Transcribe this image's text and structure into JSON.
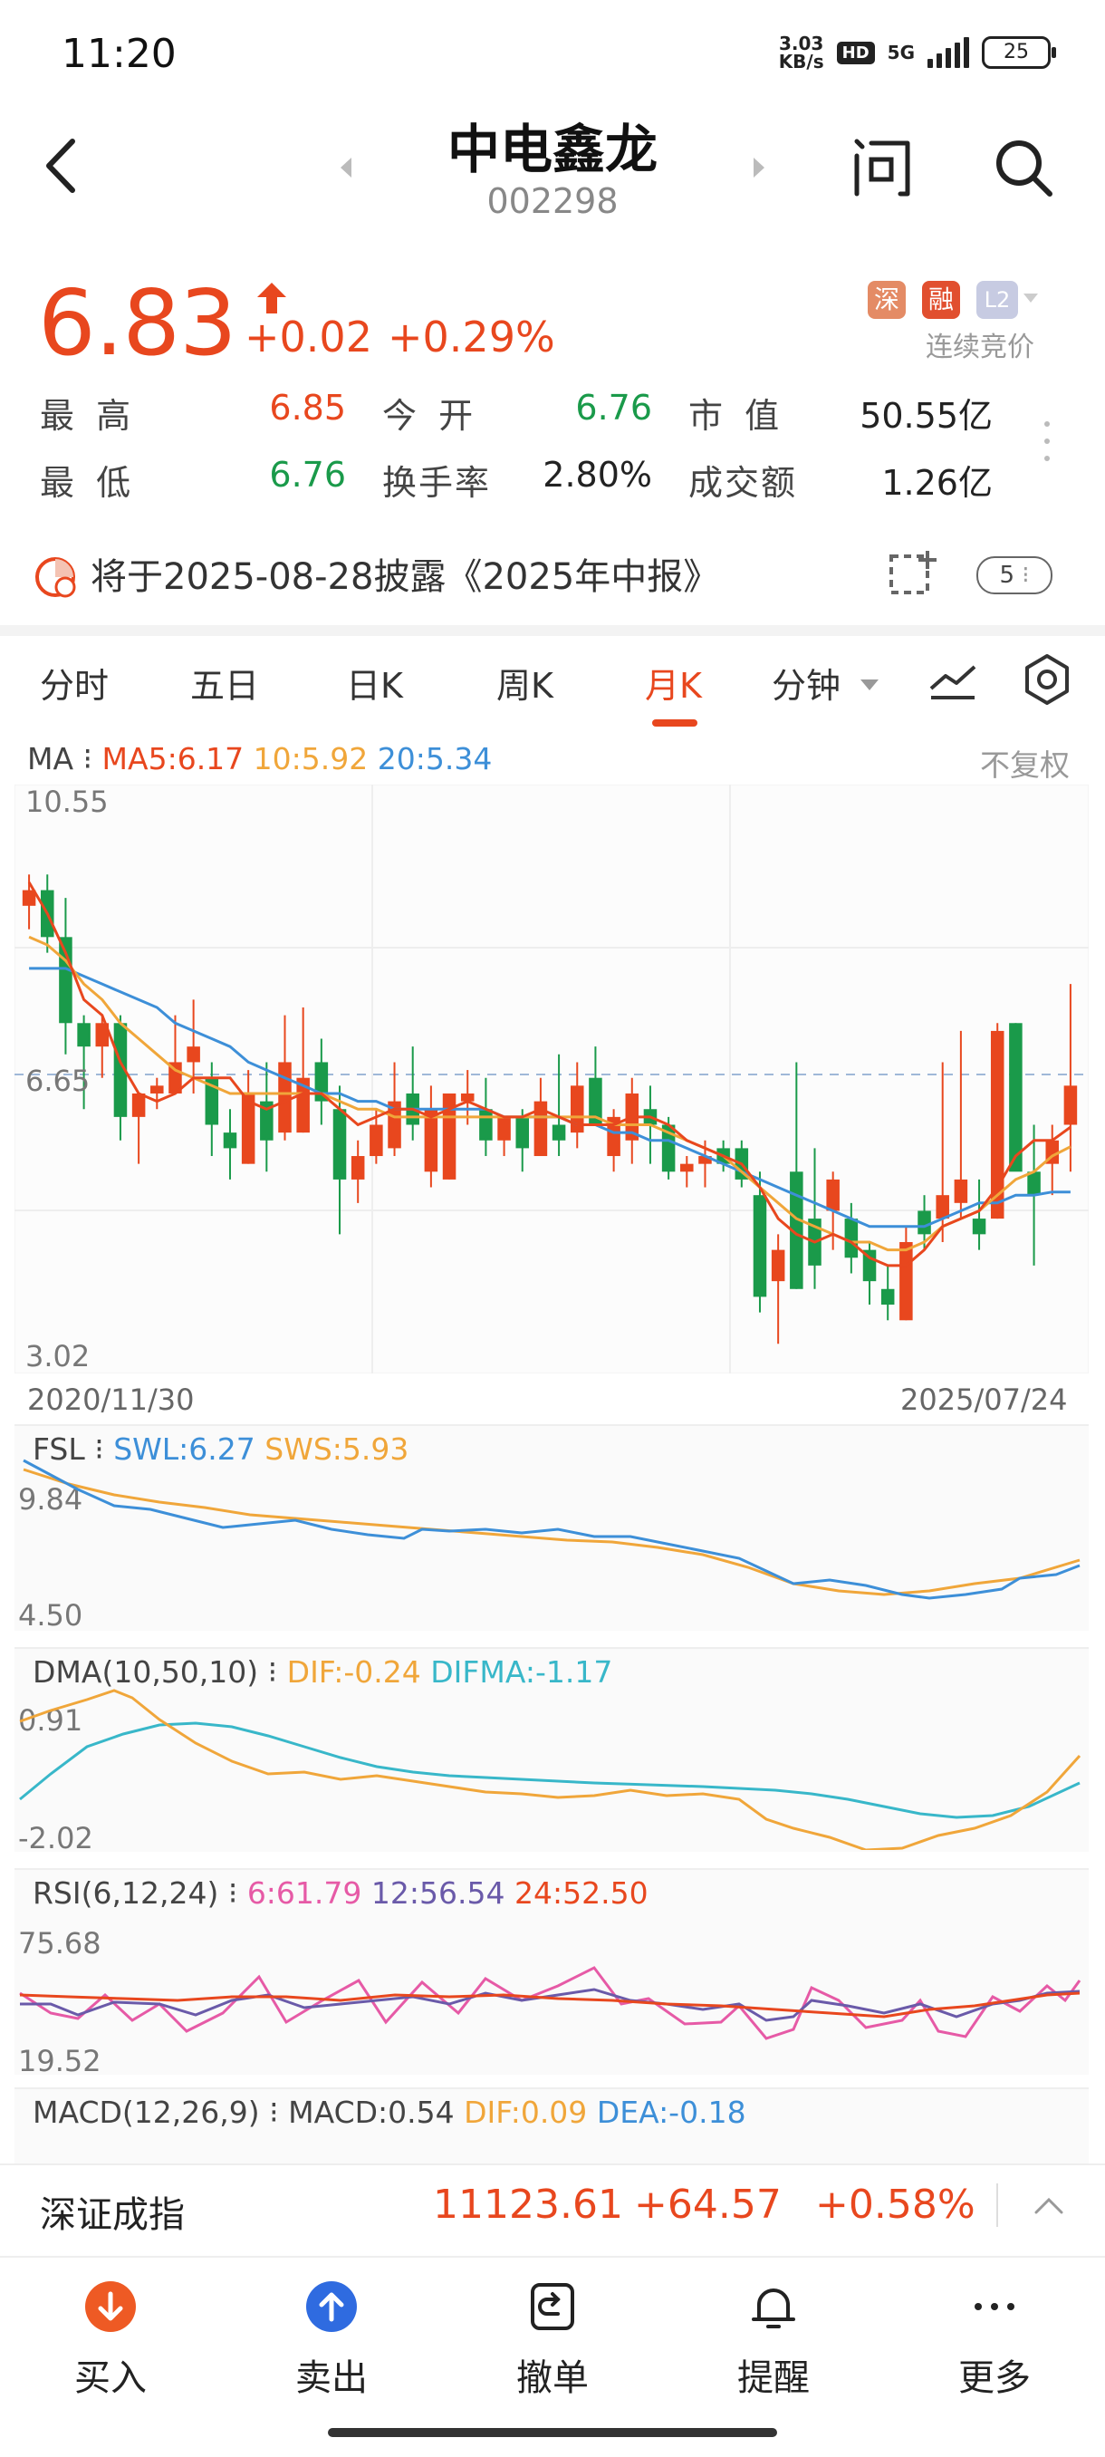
{
  "status": {
    "time": "11:20",
    "speed_top": "3.03",
    "speed_bottom": "KB/s",
    "hd": "HD",
    "net": "5G",
    "battery": "25"
  },
  "header": {
    "title": "中电鑫龙",
    "code": "002298"
  },
  "quote": {
    "price": "6.83",
    "change": "+0.02",
    "change_pct": "+0.29%",
    "badge_shen": "深",
    "badge_rong": "融",
    "badge_l2": "L2",
    "auction": "连续竞价",
    "high_label": "最 高",
    "high": "6.85",
    "open_label": "今 开",
    "open": "6.76",
    "mcap_label": "市 值",
    "mcap": "50.55亿",
    "low_label": "最 低",
    "low": "6.76",
    "turnover_label": "换手率",
    "turnover": "2.80%",
    "amount_label": "成交额",
    "amount": "1.26亿"
  },
  "notice": {
    "text": "将于2025-08-28披露《2025年中报》",
    "count": "5"
  },
  "tabs": [
    "分时",
    "五日",
    "日K",
    "周K",
    "月K",
    "分钟"
  ],
  "active_tab": "月K",
  "colors": {
    "red": "#e8471e",
    "green": "#1a9a4a",
    "orange": "#f0a63a",
    "blue": "#3d8fd8",
    "cyan": "#38b7c9",
    "pink": "#e65aa6",
    "purple": "#6a5aa9"
  },
  "main_chart": {
    "legend_title": "MA",
    "ma5": "MA5:6.17",
    "ma10": "10:5.92",
    "ma20": "20:5.34",
    "adjust": "不复权",
    "y_top": "10.55",
    "y_mid": "6.65",
    "y_bottom": "3.02",
    "date_start": "2020/11/30",
    "date_end": "2025/07/24"
  },
  "fsl": {
    "title": "FSL",
    "swl": "SWL:6.27",
    "sws": "SWS:5.93",
    "y_top": "9.84",
    "y_bottom": "4.50"
  },
  "dma": {
    "title": "DMA(10,50,10)",
    "dif": "DIF:-0.24",
    "difma": "DIFMA:-1.17",
    "y_top": "0.91",
    "y_bottom": "-2.02"
  },
  "rsi": {
    "title": "RSI(6,12,24)",
    "r6": "6:61.79",
    "r12": "12:56.54",
    "r24": "24:52.50",
    "y_top": "75.68",
    "y_bottom": "19.52"
  },
  "macd": {
    "title": "MACD(12,26,9)",
    "macd": "MACD:0.54",
    "dif": "DIF:0.09",
    "dea": "DEA:-0.18"
  },
  "index": {
    "name": "深证成指",
    "value": "11123.61",
    "change": "+64.57",
    "pct": "+0.58%"
  },
  "toolbar": {
    "buy": "买入",
    "sell": "卖出",
    "cancel": "撤单",
    "alert": "提醒",
    "more": "更多"
  },
  "chart_data": {
    "type": "candlestick",
    "x_range": [
      "2020/11/30",
      "2025/07/24"
    ],
    "ylim": [
      3.02,
      10.55
    ],
    "reference_price": 6.65,
    "candles": [
      [
        9.0,
        9.4,
        8.7,
        9.2
      ],
      [
        9.2,
        9.4,
        8.4,
        8.6
      ],
      [
        8.6,
        9.1,
        7.1,
        7.5
      ],
      [
        7.5,
        7.6,
        6.4,
        7.2
      ],
      [
        7.2,
        7.6,
        6.8,
        7.5
      ],
      [
        7.5,
        7.6,
        6.0,
        6.3
      ],
      [
        6.3,
        6.6,
        5.7,
        6.6
      ],
      [
        6.6,
        6.8,
        6.4,
        6.7
      ],
      [
        6.6,
        7.6,
        6.6,
        7.0
      ],
      [
        7.0,
        7.8,
        6.6,
        7.2
      ],
      [
        6.8,
        7.0,
        5.8,
        6.2
      ],
      [
        6.1,
        6.4,
        5.5,
        5.9
      ],
      [
        5.7,
        6.9,
        5.7,
        6.6
      ],
      [
        6.5,
        7.0,
        5.6,
        6.0
      ],
      [
        6.1,
        7.6,
        6.0,
        7.0
      ],
      [
        6.1,
        7.7,
        6.1,
        6.8
      ],
      [
        7.0,
        7.3,
        6.2,
        6.5
      ],
      [
        6.4,
        6.7,
        4.8,
        5.5
      ],
      [
        5.5,
        6.0,
        5.2,
        5.8
      ],
      [
        5.8,
        6.4,
        5.7,
        6.2
      ],
      [
        5.9,
        7.0,
        5.8,
        6.5
      ],
      [
        6.6,
        7.2,
        6.0,
        6.2
      ],
      [
        5.6,
        6.7,
        5.4,
        6.4
      ],
      [
        5.5,
        6.6,
        5.5,
        6.6
      ],
      [
        6.5,
        6.9,
        6.2,
        6.6
      ],
      [
        6.4,
        6.8,
        5.8,
        6.0
      ],
      [
        6.0,
        6.2,
        5.8,
        6.3
      ],
      [
        6.3,
        6.4,
        5.6,
        5.9
      ],
      [
        5.8,
        6.8,
        5.8,
        6.5
      ],
      [
        6.2,
        7.1,
        5.8,
        6.0
      ],
      [
        6.1,
        7.0,
        5.9,
        6.7
      ],
      [
        6.8,
        7.2,
        6.2,
        6.2
      ],
      [
        5.8,
        6.4,
        5.6,
        6.3
      ],
      [
        6.0,
        6.8,
        5.7,
        6.6
      ],
      [
        6.4,
        6.7,
        5.7,
        6.2
      ],
      [
        6.2,
        6.3,
        5.5,
        5.6
      ],
      [
        5.6,
        5.8,
        5.4,
        5.7
      ],
      [
        5.7,
        6.0,
        5.4,
        5.8
      ],
      [
        5.9,
        6.0,
        5.6,
        5.7
      ],
      [
        5.9,
        6.0,
        5.4,
        5.5
      ],
      [
        5.3,
        5.6,
        3.8,
        4.0
      ],
      [
        4.2,
        4.8,
        3.4,
        4.6
      ],
      [
        5.6,
        7.0,
        4.1,
        4.1
      ],
      [
        5.0,
        5.9,
        4.1,
        4.4
      ],
      [
        5.1,
        5.6,
        4.6,
        5.5
      ],
      [
        5.0,
        5.2,
        4.3,
        4.5
      ],
      [
        4.6,
        4.7,
        3.9,
        4.2
      ],
      [
        4.1,
        4.4,
        3.7,
        3.9
      ],
      [
        3.7,
        4.9,
        3.7,
        4.7
      ],
      [
        5.1,
        5.3,
        4.6,
        4.8
      ],
      [
        5.0,
        7.0,
        4.7,
        5.3
      ],
      [
        5.2,
        7.4,
        5.0,
        5.5
      ],
      [
        5.0,
        5.5,
        4.6,
        4.8
      ],
      [
        5.0,
        7.5,
        5.0,
        7.4
      ],
      [
        7.5,
        7.5,
        5.7,
        5.6
      ],
      [
        5.6,
        6.2,
        4.4,
        5.3
      ],
      [
        5.7,
        6.2,
        5.3,
        6.0
      ],
      [
        6.2,
        8.0,
        5.6,
        6.7
      ]
    ],
    "ma5": [
      9.3,
      8.9,
      8.4,
      7.8,
      7.6,
      7.0,
      6.6,
      6.5,
      6.6,
      6.8,
      6.8,
      6.8,
      6.5,
      6.4,
      6.5,
      6.6,
      6.6,
      6.4,
      6.2,
      6.3,
      6.4,
      6.4,
      6.3,
      6.4,
      6.5,
      6.4,
      6.3,
      6.3,
      6.4,
      6.3,
      6.2,
      6.2,
      6.2,
      6.3,
      6.3,
      6.2,
      6.0,
      5.9,
      5.8,
      5.7,
      5.4,
      5.0,
      4.8,
      4.7,
      4.8,
      4.7,
      4.5,
      4.4,
      4.4,
      4.6,
      4.9,
      5.0,
      5.1,
      5.4,
      5.8,
      6.0,
      6.0,
      6.17
    ],
    "ma10": [
      8.6,
      8.5,
      8.3,
      8.0,
      7.8,
      7.5,
      7.3,
      7.1,
      6.9,
      6.8,
      6.7,
      6.6,
      6.6,
      6.6,
      6.6,
      6.6,
      6.6,
      6.5,
      6.4,
      6.4,
      6.3,
      6.3,
      6.3,
      6.3,
      6.3,
      6.3,
      6.3,
      6.3,
      6.3,
      6.3,
      6.3,
      6.3,
      6.2,
      6.2,
      6.2,
      6.1,
      6.0,
      5.9,
      5.8,
      5.6,
      5.4,
      5.2,
      5.0,
      4.9,
      4.8,
      4.7,
      4.7,
      4.6,
      4.6,
      4.7,
      4.9,
      5.0,
      5.1,
      5.3,
      5.5,
      5.6,
      5.8,
      5.92
    ],
    "ma20": [
      8.2,
      8.2,
      8.2,
      8.1,
      8.0,
      7.9,
      7.8,
      7.7,
      7.5,
      7.4,
      7.3,
      7.2,
      7.0,
      6.9,
      6.8,
      6.7,
      6.6,
      6.6,
      6.5,
      6.5,
      6.4,
      6.4,
      6.4,
      6.4,
      6.4,
      6.4,
      6.3,
      6.3,
      6.3,
      6.3,
      6.2,
      6.2,
      6.1,
      6.1,
      6.0,
      6.0,
      5.9,
      5.8,
      5.7,
      5.6,
      5.5,
      5.4,
      5.3,
      5.2,
      5.1,
      5.0,
      4.9,
      4.9,
      4.9,
      4.9,
      5.0,
      5.1,
      5.2,
      5.2,
      5.3,
      5.3,
      5.34,
      5.34
    ]
  }
}
